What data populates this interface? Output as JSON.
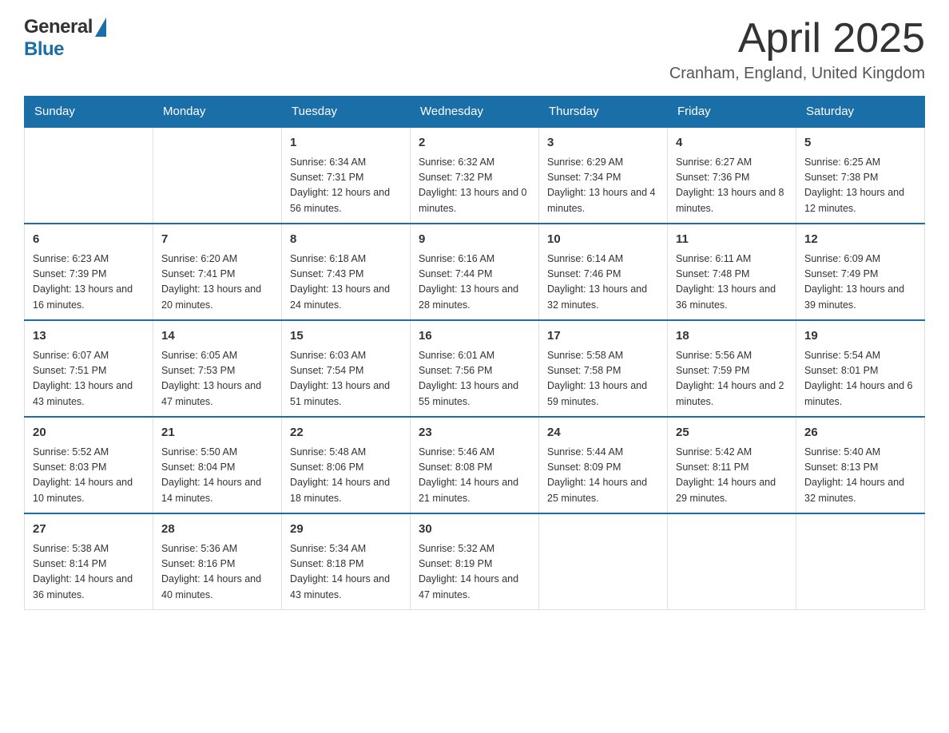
{
  "header": {
    "month_year": "April 2025",
    "location": "Cranham, England, United Kingdom",
    "logo_general": "General",
    "logo_blue": "Blue"
  },
  "days_of_week": [
    "Sunday",
    "Monday",
    "Tuesday",
    "Wednesday",
    "Thursday",
    "Friday",
    "Saturday"
  ],
  "weeks": [
    [
      {
        "day": "",
        "sunrise": "",
        "sunset": "",
        "daylight": ""
      },
      {
        "day": "",
        "sunrise": "",
        "sunset": "",
        "daylight": ""
      },
      {
        "day": "1",
        "sunrise": "Sunrise: 6:34 AM",
        "sunset": "Sunset: 7:31 PM",
        "daylight": "Daylight: 12 hours and 56 minutes."
      },
      {
        "day": "2",
        "sunrise": "Sunrise: 6:32 AM",
        "sunset": "Sunset: 7:32 PM",
        "daylight": "Daylight: 13 hours and 0 minutes."
      },
      {
        "day": "3",
        "sunrise": "Sunrise: 6:29 AM",
        "sunset": "Sunset: 7:34 PM",
        "daylight": "Daylight: 13 hours and 4 minutes."
      },
      {
        "day": "4",
        "sunrise": "Sunrise: 6:27 AM",
        "sunset": "Sunset: 7:36 PM",
        "daylight": "Daylight: 13 hours and 8 minutes."
      },
      {
        "day": "5",
        "sunrise": "Sunrise: 6:25 AM",
        "sunset": "Sunset: 7:38 PM",
        "daylight": "Daylight: 13 hours and 12 minutes."
      }
    ],
    [
      {
        "day": "6",
        "sunrise": "Sunrise: 6:23 AM",
        "sunset": "Sunset: 7:39 PM",
        "daylight": "Daylight: 13 hours and 16 minutes."
      },
      {
        "day": "7",
        "sunrise": "Sunrise: 6:20 AM",
        "sunset": "Sunset: 7:41 PM",
        "daylight": "Daylight: 13 hours and 20 minutes."
      },
      {
        "day": "8",
        "sunrise": "Sunrise: 6:18 AM",
        "sunset": "Sunset: 7:43 PM",
        "daylight": "Daylight: 13 hours and 24 minutes."
      },
      {
        "day": "9",
        "sunrise": "Sunrise: 6:16 AM",
        "sunset": "Sunset: 7:44 PM",
        "daylight": "Daylight: 13 hours and 28 minutes."
      },
      {
        "day": "10",
        "sunrise": "Sunrise: 6:14 AM",
        "sunset": "Sunset: 7:46 PM",
        "daylight": "Daylight: 13 hours and 32 minutes."
      },
      {
        "day": "11",
        "sunrise": "Sunrise: 6:11 AM",
        "sunset": "Sunset: 7:48 PM",
        "daylight": "Daylight: 13 hours and 36 minutes."
      },
      {
        "day": "12",
        "sunrise": "Sunrise: 6:09 AM",
        "sunset": "Sunset: 7:49 PM",
        "daylight": "Daylight: 13 hours and 39 minutes."
      }
    ],
    [
      {
        "day": "13",
        "sunrise": "Sunrise: 6:07 AM",
        "sunset": "Sunset: 7:51 PM",
        "daylight": "Daylight: 13 hours and 43 minutes."
      },
      {
        "day": "14",
        "sunrise": "Sunrise: 6:05 AM",
        "sunset": "Sunset: 7:53 PM",
        "daylight": "Daylight: 13 hours and 47 minutes."
      },
      {
        "day": "15",
        "sunrise": "Sunrise: 6:03 AM",
        "sunset": "Sunset: 7:54 PM",
        "daylight": "Daylight: 13 hours and 51 minutes."
      },
      {
        "day": "16",
        "sunrise": "Sunrise: 6:01 AM",
        "sunset": "Sunset: 7:56 PM",
        "daylight": "Daylight: 13 hours and 55 minutes."
      },
      {
        "day": "17",
        "sunrise": "Sunrise: 5:58 AM",
        "sunset": "Sunset: 7:58 PM",
        "daylight": "Daylight: 13 hours and 59 minutes."
      },
      {
        "day": "18",
        "sunrise": "Sunrise: 5:56 AM",
        "sunset": "Sunset: 7:59 PM",
        "daylight": "Daylight: 14 hours and 2 minutes."
      },
      {
        "day": "19",
        "sunrise": "Sunrise: 5:54 AM",
        "sunset": "Sunset: 8:01 PM",
        "daylight": "Daylight: 14 hours and 6 minutes."
      }
    ],
    [
      {
        "day": "20",
        "sunrise": "Sunrise: 5:52 AM",
        "sunset": "Sunset: 8:03 PM",
        "daylight": "Daylight: 14 hours and 10 minutes."
      },
      {
        "day": "21",
        "sunrise": "Sunrise: 5:50 AM",
        "sunset": "Sunset: 8:04 PM",
        "daylight": "Daylight: 14 hours and 14 minutes."
      },
      {
        "day": "22",
        "sunrise": "Sunrise: 5:48 AM",
        "sunset": "Sunset: 8:06 PM",
        "daylight": "Daylight: 14 hours and 18 minutes."
      },
      {
        "day": "23",
        "sunrise": "Sunrise: 5:46 AM",
        "sunset": "Sunset: 8:08 PM",
        "daylight": "Daylight: 14 hours and 21 minutes."
      },
      {
        "day": "24",
        "sunrise": "Sunrise: 5:44 AM",
        "sunset": "Sunset: 8:09 PM",
        "daylight": "Daylight: 14 hours and 25 minutes."
      },
      {
        "day": "25",
        "sunrise": "Sunrise: 5:42 AM",
        "sunset": "Sunset: 8:11 PM",
        "daylight": "Daylight: 14 hours and 29 minutes."
      },
      {
        "day": "26",
        "sunrise": "Sunrise: 5:40 AM",
        "sunset": "Sunset: 8:13 PM",
        "daylight": "Daylight: 14 hours and 32 minutes."
      }
    ],
    [
      {
        "day": "27",
        "sunrise": "Sunrise: 5:38 AM",
        "sunset": "Sunset: 8:14 PM",
        "daylight": "Daylight: 14 hours and 36 minutes."
      },
      {
        "day": "28",
        "sunrise": "Sunrise: 5:36 AM",
        "sunset": "Sunset: 8:16 PM",
        "daylight": "Daylight: 14 hours and 40 minutes."
      },
      {
        "day": "29",
        "sunrise": "Sunrise: 5:34 AM",
        "sunset": "Sunset: 8:18 PM",
        "daylight": "Daylight: 14 hours and 43 minutes."
      },
      {
        "day": "30",
        "sunrise": "Sunrise: 5:32 AM",
        "sunset": "Sunset: 8:19 PM",
        "daylight": "Daylight: 14 hours and 47 minutes."
      },
      {
        "day": "",
        "sunrise": "",
        "sunset": "",
        "daylight": ""
      },
      {
        "day": "",
        "sunrise": "",
        "sunset": "",
        "daylight": ""
      },
      {
        "day": "",
        "sunrise": "",
        "sunset": "",
        "daylight": ""
      }
    ]
  ]
}
